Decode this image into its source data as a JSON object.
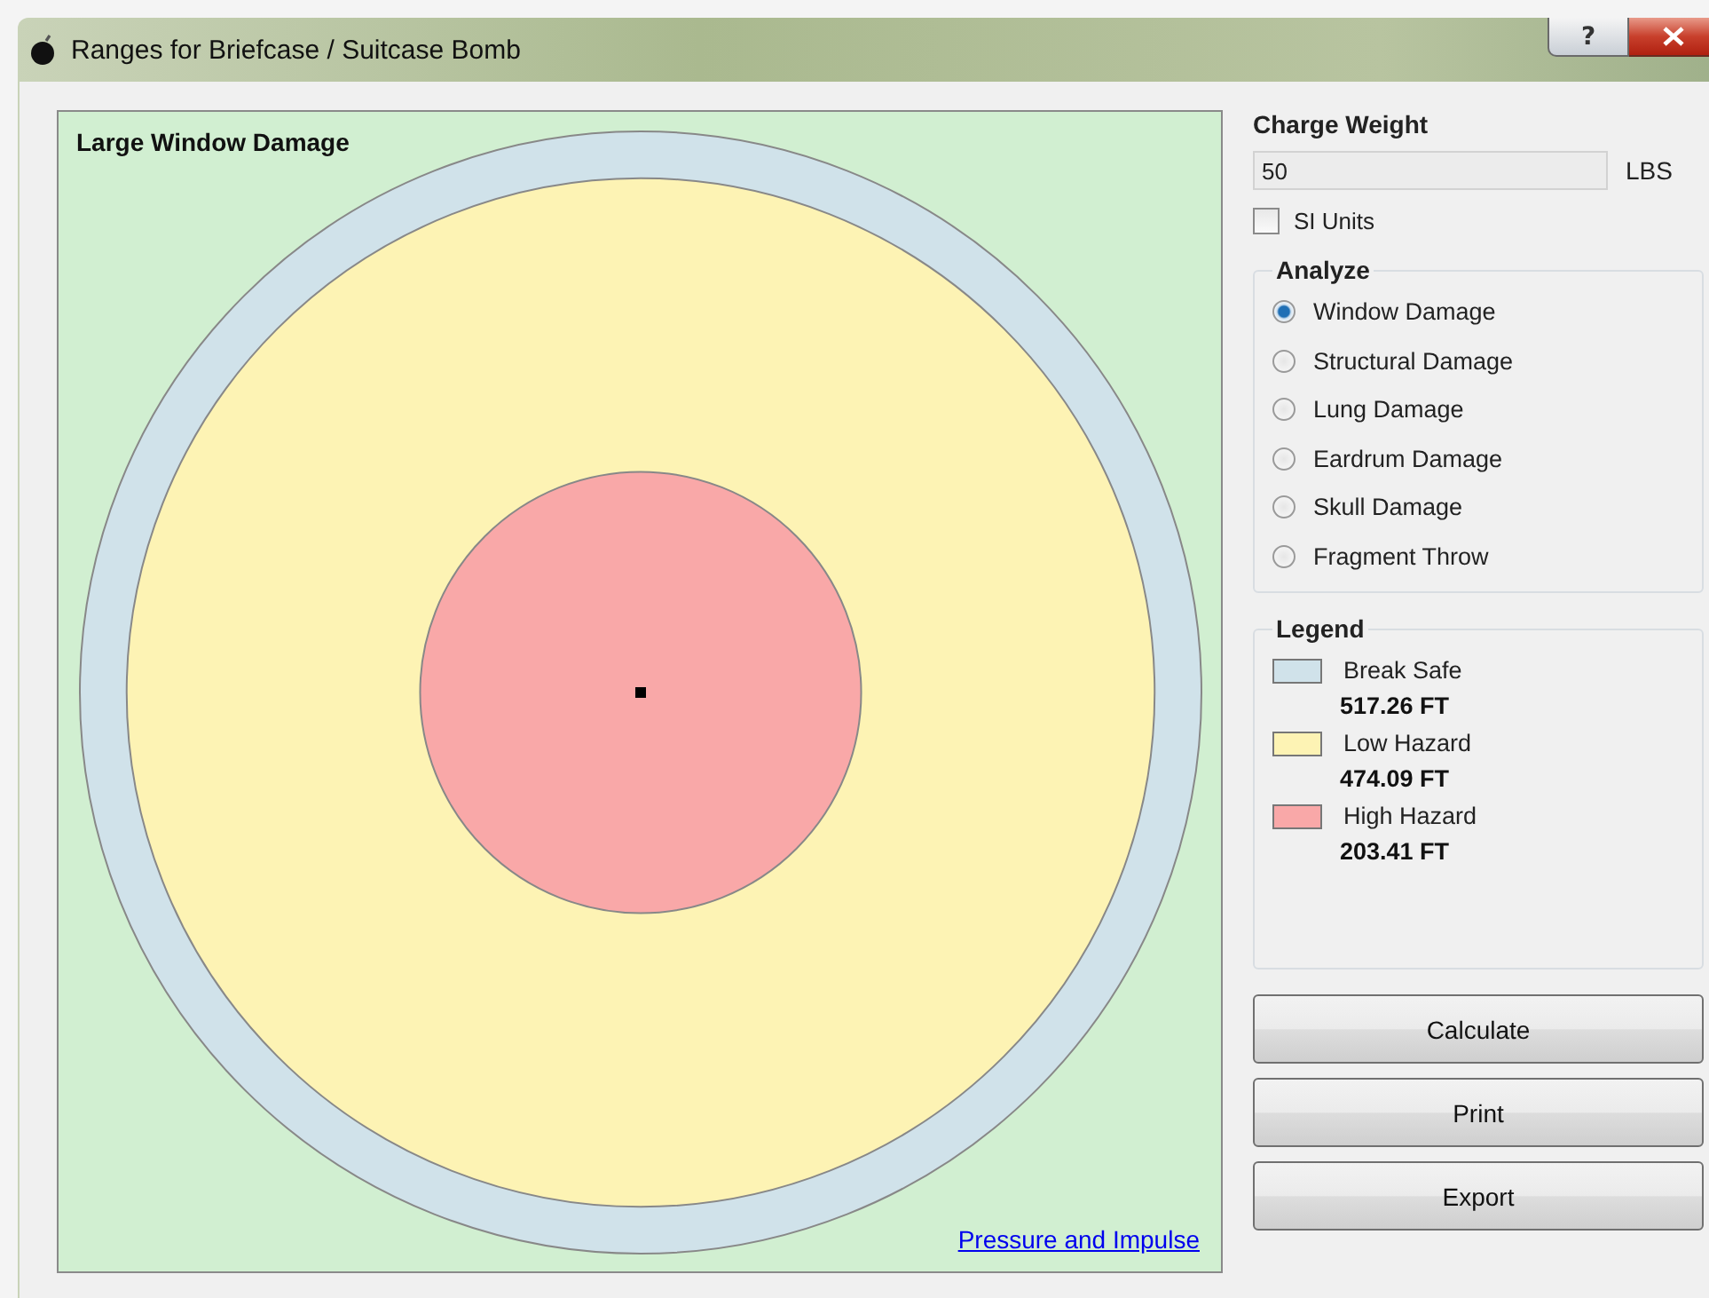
{
  "window": {
    "title": "Ranges for Briefcase / Suitcase Bomb",
    "help_button": "?"
  },
  "diagram": {
    "title": "Large Window Damage",
    "link": "Pressure and Impulse"
  },
  "charge_weight": {
    "label": "Charge Weight",
    "value": "50",
    "unit": "LBS"
  },
  "si_units": {
    "label": "SI Units",
    "checked": false
  },
  "analyze": {
    "title": "Analyze",
    "options": [
      {
        "label": "Window Damage",
        "selected": true
      },
      {
        "label": "Structural Damage",
        "selected": false
      },
      {
        "label": "Lung Damage",
        "selected": false
      },
      {
        "label": "Eardrum Damage",
        "selected": false
      },
      {
        "label": "Skull Damage",
        "selected": false
      },
      {
        "label": "Fragment Throw",
        "selected": false
      }
    ]
  },
  "legend": {
    "title": "Legend",
    "items": [
      {
        "label": "Break Safe",
        "value": "517.26 FT",
        "color": "#d0e2ea"
      },
      {
        "label": "Low Hazard",
        "value": "474.09 FT",
        "color": "#fdf3b4"
      },
      {
        "label": "High Hazard",
        "value": "203.41 FT",
        "color": "#f9a8a8"
      }
    ]
  },
  "buttons": [
    "Calculate",
    "Print",
    "Export"
  ]
}
